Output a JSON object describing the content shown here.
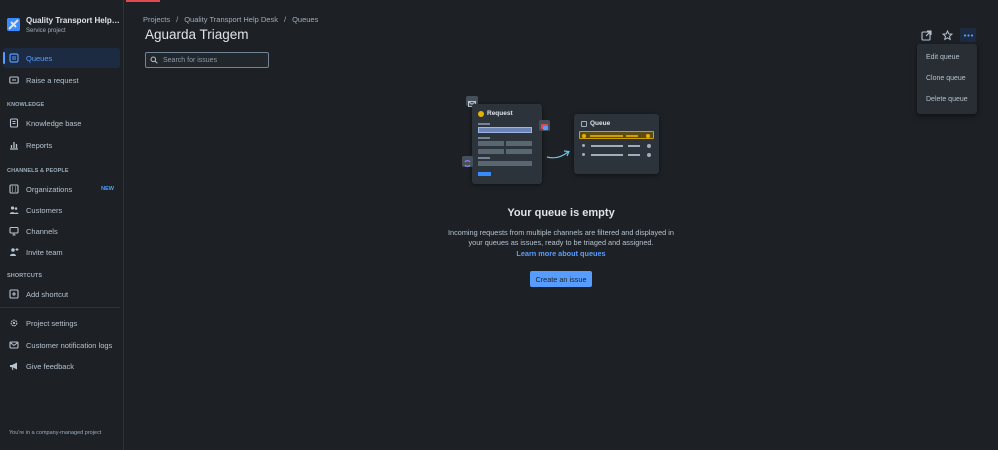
{
  "colors": {
    "accent": "#579dff",
    "background": "#1d2125",
    "alert": "#e2484d"
  },
  "project": {
    "name": "Quality Transport Help D...",
    "type": "Service project"
  },
  "sidebar": {
    "items": [
      {
        "label": "Queues",
        "icon": "queues-icon",
        "active": true
      },
      {
        "label": "Raise a request",
        "icon": "raise-request-icon"
      }
    ],
    "knowledge": {
      "heading": "KNOWLEDGE",
      "items": [
        {
          "label": "Knowledge base",
          "icon": "book-icon"
        },
        {
          "label": "Reports",
          "icon": "chart-icon"
        }
      ]
    },
    "channels": {
      "heading": "CHANNELS & PEOPLE",
      "items": [
        {
          "label": "Organizations",
          "icon": "building-icon",
          "badge": "NEW"
        },
        {
          "label": "Customers",
          "icon": "people-icon"
        },
        {
          "label": "Channels",
          "icon": "monitor-icon"
        },
        {
          "label": "Invite team",
          "icon": "person-add-icon"
        }
      ]
    },
    "shortcuts": {
      "heading": "SHORTCUTS",
      "items": [
        {
          "label": "Add shortcut",
          "icon": "add-icon"
        }
      ]
    },
    "bottom": [
      {
        "label": "Project settings",
        "icon": "gear-icon"
      },
      {
        "label": "Customer notification logs",
        "icon": "mail-icon"
      },
      {
        "label": "Give feedback",
        "icon": "megaphone-icon"
      }
    ],
    "footer": "You're in a company-managed project"
  },
  "breadcrumb": [
    "Projects",
    "Quality Transport Help Desk",
    "Queues"
  ],
  "page": {
    "title": "Aguarda Triagem"
  },
  "search": {
    "placeholder": "Search for issues"
  },
  "menu": {
    "items": [
      "Edit queue",
      "Clone queue",
      "Delete queue"
    ]
  },
  "illustration": {
    "request_label": "Request",
    "queue_label": "Queue"
  },
  "empty_state": {
    "title": "Your queue is empty",
    "description": "Incoming requests from multiple channels are filtered and displayed in your queues as issues, ready to be triaged and assigned.",
    "link": "Learn more about queues",
    "button": "Create an issue"
  }
}
